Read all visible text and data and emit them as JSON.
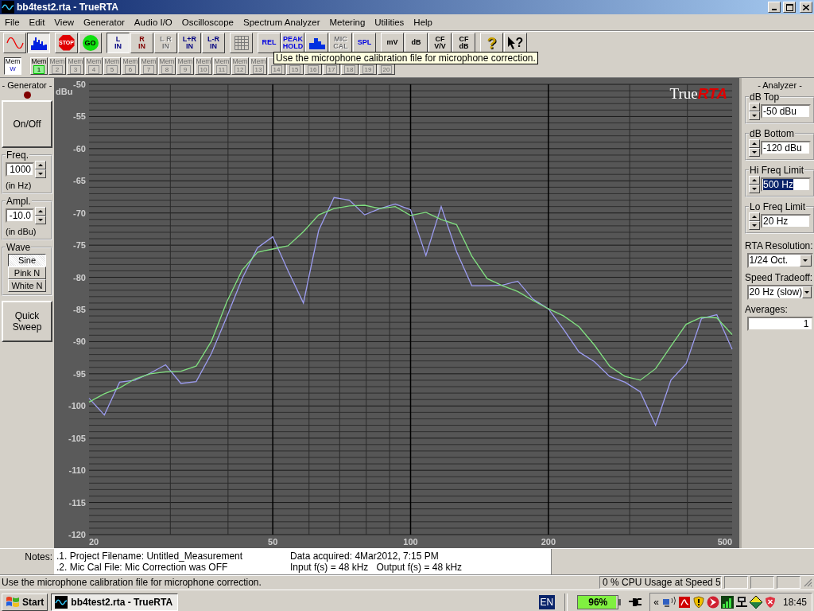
{
  "window": {
    "title": "bb4test2.rta - TrueRTA"
  },
  "menu": [
    "File",
    "Edit",
    "View",
    "Generator",
    "Audio I/O",
    "Oscilloscope",
    "Spectrum Analyzer",
    "Metering",
    "Utilities",
    "Help"
  ],
  "toolbar": [
    [
      {
        "kind": "wave",
        "selected": false,
        "disabled": false
      },
      {
        "kind": "spectrum",
        "selected": true,
        "disabled": false
      }
    ],
    [
      {
        "kind": "stop",
        "label": "STOP",
        "selected": false,
        "disabled": false
      },
      {
        "kind": "go",
        "label": "GO",
        "selected": false,
        "disabled": false
      }
    ],
    [
      {
        "kind": "text",
        "lines": [
          "L",
          "IN"
        ],
        "color": "#000080",
        "selected": true,
        "disabled": false
      },
      {
        "kind": "text",
        "lines": [
          "R",
          "IN"
        ],
        "color": "#800000",
        "selected": false,
        "disabled": false
      },
      {
        "kind": "text",
        "lines": [
          "L R",
          "IN"
        ],
        "selected": false,
        "disabled": true
      },
      {
        "kind": "text",
        "lines": [
          "L+R",
          "IN"
        ],
        "color": "#000080",
        "selected": false,
        "disabled": false
      },
      {
        "kind": "text",
        "lines": [
          "L-R",
          "IN"
        ],
        "color": "#000080",
        "selected": false,
        "disabled": false
      }
    ],
    [
      {
        "kind": "grid",
        "selected": false,
        "disabled": false
      }
    ],
    [
      {
        "kind": "text",
        "lines": [
          "REL"
        ],
        "color": "#0000e0",
        "selected": false,
        "disabled": false
      },
      {
        "kind": "text",
        "lines": [
          "PEAK",
          "HOLD"
        ],
        "color": "#0000e0",
        "selected": false,
        "disabled": false
      },
      {
        "kind": "blocks",
        "selected": false,
        "disabled": false
      },
      {
        "kind": "text",
        "lines": [
          "MIC",
          "CAL"
        ],
        "selected": false,
        "disabled": true
      },
      {
        "kind": "text",
        "lines": [
          "SPL"
        ],
        "color": "#0000e0",
        "selected": false,
        "disabled": false
      }
    ],
    [
      {
        "kind": "text",
        "lines": [
          "mV"
        ],
        "color": "#000000",
        "selected": false,
        "disabled": false
      },
      {
        "kind": "text",
        "lines": [
          "dB"
        ],
        "color": "#000000",
        "selected": false,
        "disabled": false
      },
      {
        "kind": "text",
        "lines": [
          "CF",
          "V/V"
        ],
        "color": "#000000",
        "selected": false,
        "disabled": false
      },
      {
        "kind": "text",
        "lines": [
          "CF",
          "dB"
        ],
        "color": "#000000",
        "selected": false,
        "disabled": false
      }
    ],
    [
      {
        "kind": "help",
        "label": "?",
        "selected": false,
        "disabled": false
      },
      {
        "kind": "pointer",
        "label": "?",
        "selected": false,
        "disabled": false
      }
    ]
  ],
  "memories": [
    {
      "label": "Mem",
      "number": "W",
      "selected": true,
      "disabled": false
    },
    {
      "label": "Mem",
      "number": "1",
      "selected": false,
      "disabled": false
    },
    {
      "label": "Mem",
      "number": "2",
      "selected": false,
      "disabled": true
    },
    {
      "label": "Mem",
      "number": "3",
      "selected": false,
      "disabled": true
    },
    {
      "label": "Mem",
      "number": "4",
      "selected": false,
      "disabled": true
    },
    {
      "label": "Mem",
      "number": "5",
      "selected": false,
      "disabled": true
    },
    {
      "label": "Mem",
      "number": "6",
      "selected": false,
      "disabled": true
    },
    {
      "label": "Mem",
      "number": "7",
      "selected": false,
      "disabled": true
    },
    {
      "label": "Mem",
      "number": "8",
      "selected": false,
      "disabled": true
    },
    {
      "label": "Mem",
      "number": "9",
      "selected": false,
      "disabled": true
    },
    {
      "label": "Mem",
      "number": "10",
      "selected": false,
      "disabled": true
    },
    {
      "label": "Mem",
      "number": "11",
      "selected": false,
      "disabled": true
    },
    {
      "label": "Mem",
      "number": "12",
      "selected": false,
      "disabled": true
    },
    {
      "label": "Mem",
      "number": "13",
      "selected": false,
      "disabled": true
    },
    {
      "number": "14",
      "selected": false,
      "disabled": true
    },
    {
      "number": "15",
      "selected": false,
      "disabled": true
    },
    {
      "number": "16",
      "selected": false,
      "disabled": true
    },
    {
      "number": "17",
      "selected": false,
      "disabled": true
    },
    {
      "number": "18",
      "selected": false,
      "disabled": true
    },
    {
      "number": "19",
      "selected": false,
      "disabled": true
    },
    {
      "number": "20",
      "selected": false,
      "disabled": true
    }
  ],
  "tooltip": "Use the microphone calibration file for microphone correction.",
  "generator": {
    "title": "- Generator -",
    "led_on": false,
    "power_button": "On/Off",
    "freq": {
      "legend": "Freq.",
      "value": "1000",
      "unit": "(in Hz)"
    },
    "ampl": {
      "legend": "Ampl.",
      "value": "-10.0",
      "unit": "(in dBu)"
    },
    "wave": {
      "legend": "Wave",
      "options": [
        {
          "label": "Sine",
          "selected": true
        },
        {
          "label": "Pink N",
          "selected": false
        },
        {
          "label": "White N",
          "selected": false
        }
      ]
    },
    "sweep_button": "Quick Sweep"
  },
  "chart": {
    "logo": {
      "first": "True",
      "second": "RTA"
    },
    "chart_data": {
      "type": "line",
      "ylabel": "dBu",
      "categories": [
        "20",
        null,
        null,
        null,
        null,
        null,
        null,
        null,
        null,
        null,
        null,
        null,
        "50",
        null,
        null,
        null,
        null,
        null,
        null,
        null,
        null,
        "100",
        null,
        null,
        null,
        null,
        null,
        null,
        null,
        null,
        "200",
        null,
        null,
        null,
        null,
        null,
        null,
        null,
        null,
        null,
        null,
        null,
        "500"
      ],
      "series": [
        {
          "color": "#9c9cf0",
          "values": [
            -98.8,
            -101.4,
            -96.3,
            -96.0,
            -94.9,
            -93.6,
            -96.5,
            -96.2,
            -91.8,
            -86.1,
            -80.2,
            -75.4,
            -73.7,
            -79.0,
            -84.0,
            -72.7,
            -67.6,
            -68.0,
            -70.3,
            -69.3,
            -68.6,
            -69.5,
            -76.6,
            -69.0,
            -76.0,
            -81.3,
            -81.3,
            -81.2,
            -80.6,
            -83.4,
            -84.9,
            -88.1,
            -91.6,
            -93.1,
            -95.4,
            -96.3,
            -97.8,
            -103.0,
            -96.0,
            -93.4,
            -86.4,
            -85.8,
            -91.2
          ]
        },
        {
          "color": "#80e080",
          "values": [
            -99.4,
            -98.1,
            -97.2,
            -95.8,
            -95.0,
            -94.7,
            -94.6,
            -93.8,
            -89.9,
            -83.8,
            -78.9,
            -76.1,
            -75.6,
            -75.1,
            -72.9,
            -70.3,
            -69.3,
            -68.9,
            -68.8,
            -69.3,
            -69.0,
            -70.4,
            -69.9,
            -71.0,
            -71.8,
            -76.7,
            -80.2,
            -81.3,
            -82.2,
            -83.6,
            -84.9,
            -86.0,
            -87.7,
            -90.5,
            -93.8,
            -95.4,
            -96.0,
            -94.2,
            -90.7,
            -87.3,
            -86.2,
            -86.3,
            -88.9
          ]
        }
      ],
      "ylim": [
        -120,
        -50
      ],
      "grid": true,
      "yticks": [
        -120,
        -115,
        -110,
        -105,
        -100,
        -95,
        -90,
        -85,
        -80,
        -75,
        -70,
        -65,
        -60,
        -55,
        -50
      ]
    }
  },
  "analyzer": {
    "title": "- Analyzer -",
    "fields": [
      {
        "legend": "dB Top",
        "value": "-50 dBu",
        "selected": false
      },
      {
        "legend": "dB Bottom",
        "value": "-120 dBu",
        "selected": false
      },
      {
        "legend": "Hi Freq Limit",
        "value": "500 Hz",
        "selected": true
      },
      {
        "legend": "Lo Freq Limit",
        "value": "20 Hz",
        "selected": false
      }
    ],
    "dropdowns": [
      {
        "label": "RTA Resolution:",
        "value": "1/24 Oct."
      },
      {
        "label": "Speed Tradeoff:",
        "value": "20 Hz (slow)"
      }
    ],
    "averages": {
      "label": "Averages:",
      "value": "1"
    }
  },
  "notes": {
    "label": "Notes:",
    "lines": [
      ".1. Project Filename: Untitled_Measurement",
      ".2. Mic Cal File: Mic Correction was OFF"
    ],
    "info": [
      [
        "Data acquired: 4Mar2012, 7:15 PM"
      ],
      [
        "Input f(s) = 48 kHz",
        "Output f(s) = 48 kHz"
      ]
    ]
  },
  "status_bar": {
    "message": "Use the microphone calibration file for microphone correction.",
    "cpu": "0 % CPU Usage at Speed 5"
  },
  "taskbar": {
    "start": "Start",
    "tasks": [
      {
        "label": "bb4test2.rta - TrueRTA",
        "selected": true
      }
    ],
    "language": "EN",
    "battery": {
      "reading": "96%",
      "level": 0.96
    },
    "tray_expand": "«",
    "clock": "18:45"
  }
}
